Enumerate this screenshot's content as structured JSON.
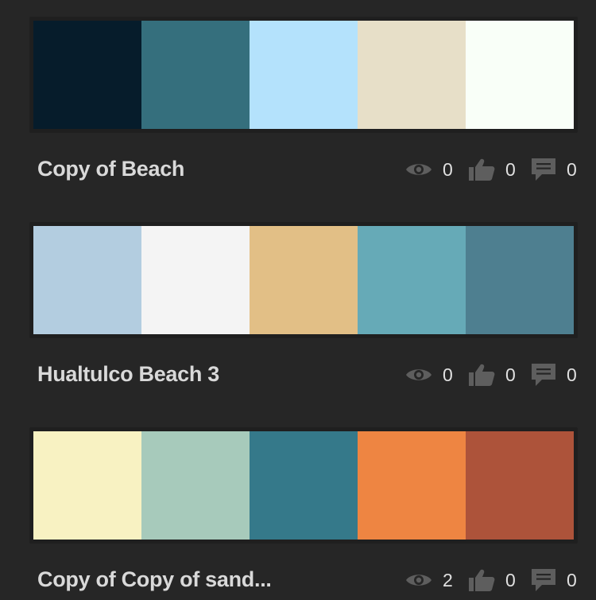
{
  "themes": [
    {
      "title": "Copy of Beach",
      "colors": [
        "#061c2b",
        "#356f7d",
        "#b4e2fc",
        "#e7dfc8",
        "#f9fff8"
      ],
      "views": "0",
      "likes": "0",
      "comments": "0"
    },
    {
      "title": "Hualtulco Beach 3",
      "colors": [
        "#b3cde0",
        "#f4f4f4",
        "#e2bf86",
        "#66aab7",
        "#4e7f90"
      ],
      "views": "0",
      "likes": "0",
      "comments": "0"
    },
    {
      "title": "Copy of Copy of sand...",
      "colors": [
        "#f8f2c2",
        "#a7cabb",
        "#35798a",
        "#ee8542",
        "#ad533a"
      ],
      "views": "2",
      "likes": "0",
      "comments": "0"
    }
  ],
  "icons": {
    "views": "eye-icon",
    "likes": "thumbs-up-icon",
    "comments": "comment-icon"
  }
}
